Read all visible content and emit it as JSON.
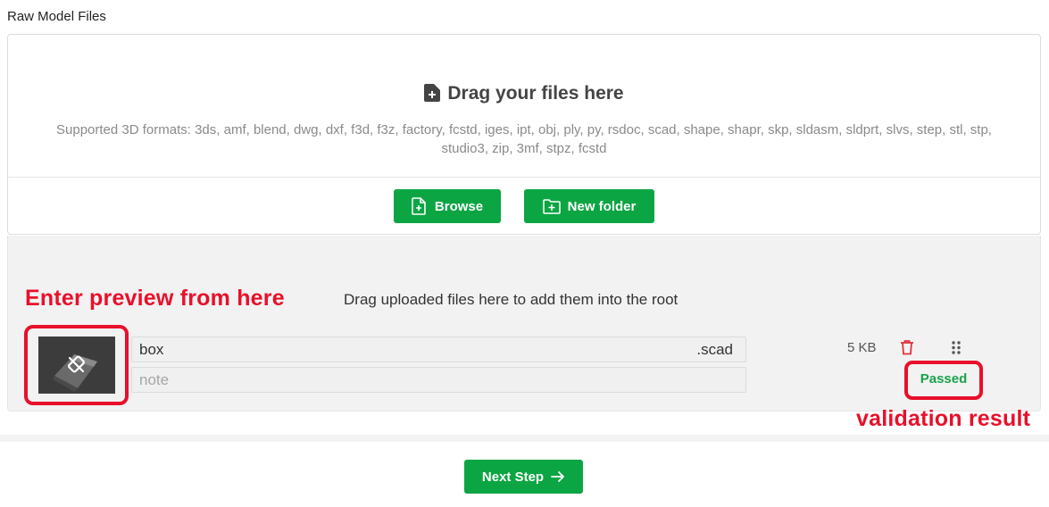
{
  "section_title": "Raw Model Files",
  "dropzone": {
    "heading": "Drag your files here",
    "formats_text": "Supported 3D formats: 3ds, amf, blend, dwg, dxf, f3d, f3z, factory, fcstd, iges, ipt, obj, ply, py, rsdoc, scad, shape, shapr, skp, sldasm, sldprt, slvs, step, stl, stp, studio3, zip, 3mf, stpz, fcstd"
  },
  "buttons": {
    "browse": "Browse",
    "new_folder": "New folder",
    "next_step": "Next Step"
  },
  "upload_area": {
    "drag_hint": "Drag uploaded files here to add them into the root"
  },
  "file": {
    "name": "box",
    "extension": ".scad",
    "note_placeholder": "note",
    "size": "5 KB",
    "status": "Passed"
  },
  "annotations": {
    "preview": "Enter preview from here",
    "validation": "validation result"
  },
  "colors": {
    "primary": "#0ca543",
    "annotation": "#e8102a",
    "status_passed": "#17a34a",
    "delete": "#e0323c"
  },
  "icons": {
    "heading": "file-add-icon",
    "browse": "file-plus-icon",
    "new_folder": "folder-plus-icon",
    "delete": "trash-icon",
    "drag": "drag-handle-icon",
    "next": "arrow-right-icon",
    "thumbnail": "model-preview-icon"
  }
}
